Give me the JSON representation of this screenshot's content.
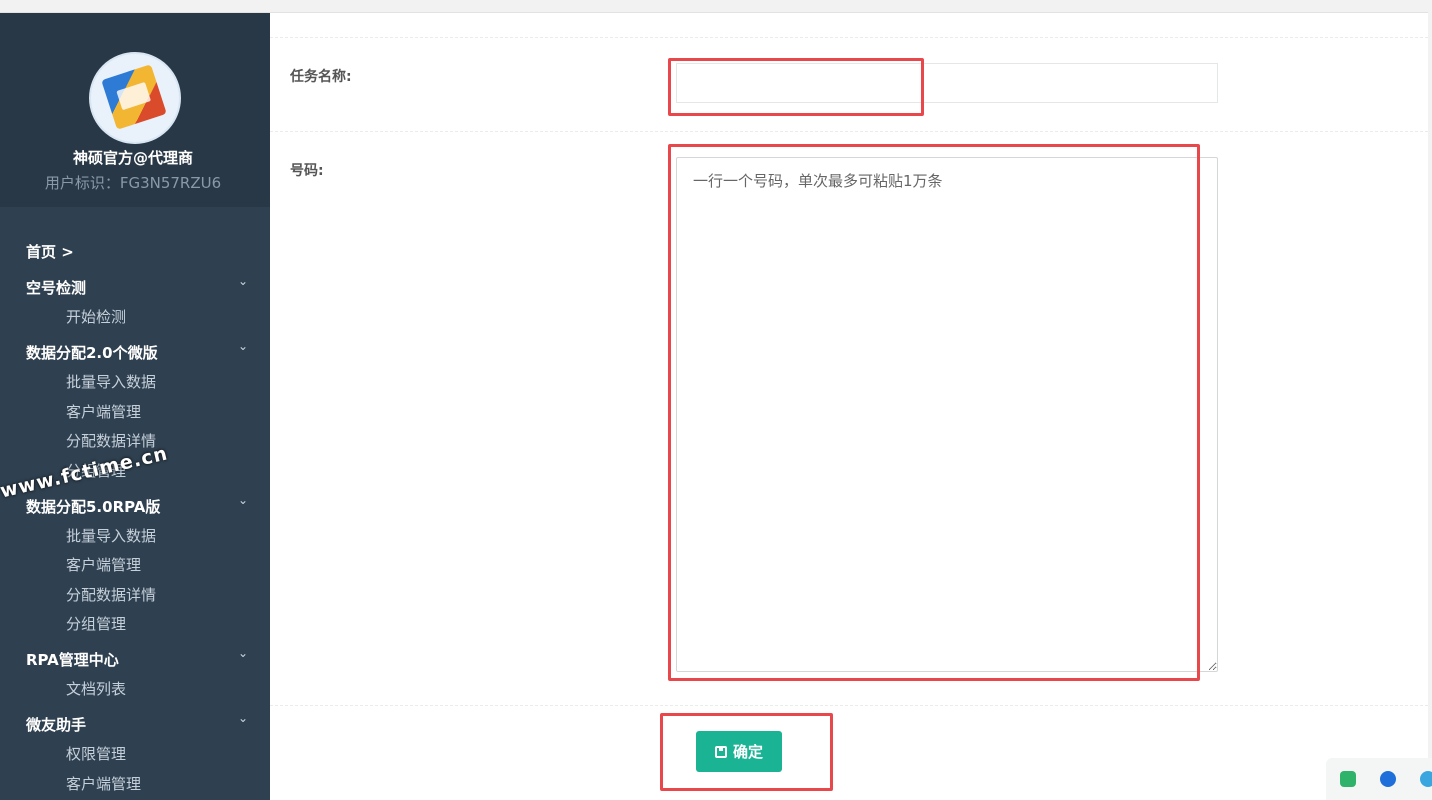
{
  "profile": {
    "name": "神硕官方@代理商",
    "user_id": "用户标识：FG3N57RZU6"
  },
  "menu": {
    "home": "首页 >",
    "groups": [
      {
        "title": "空号检测",
        "items": [
          "开始检测"
        ]
      },
      {
        "title": "数据分配2.0个微版",
        "items": [
          "批量导入数据",
          "客户端管理",
          "分配数据详情",
          "分组管理"
        ]
      },
      {
        "title": "数据分配5.0RPA版",
        "items": [
          "批量导入数据",
          "客户端管理",
          "分配数据详情",
          "分组管理"
        ]
      },
      {
        "title": "RPA管理中心",
        "items": [
          "文档列表"
        ]
      },
      {
        "title": "微友助手",
        "items": [
          "权限管理",
          "客户端管理"
        ]
      }
    ],
    "chevron": "⌄"
  },
  "form": {
    "task_name_label": "任务名称:",
    "task_name_value": "",
    "numbers_label": "号码:",
    "numbers_placeholder": "一行一个号码，单次最多可粘贴1万条",
    "confirm_label": "确定"
  },
  "watermark": "www.fctime.cn",
  "colors": {
    "sidebar": "#2f4050",
    "accent": "#1ab394",
    "highlight": "#e8474c"
  }
}
